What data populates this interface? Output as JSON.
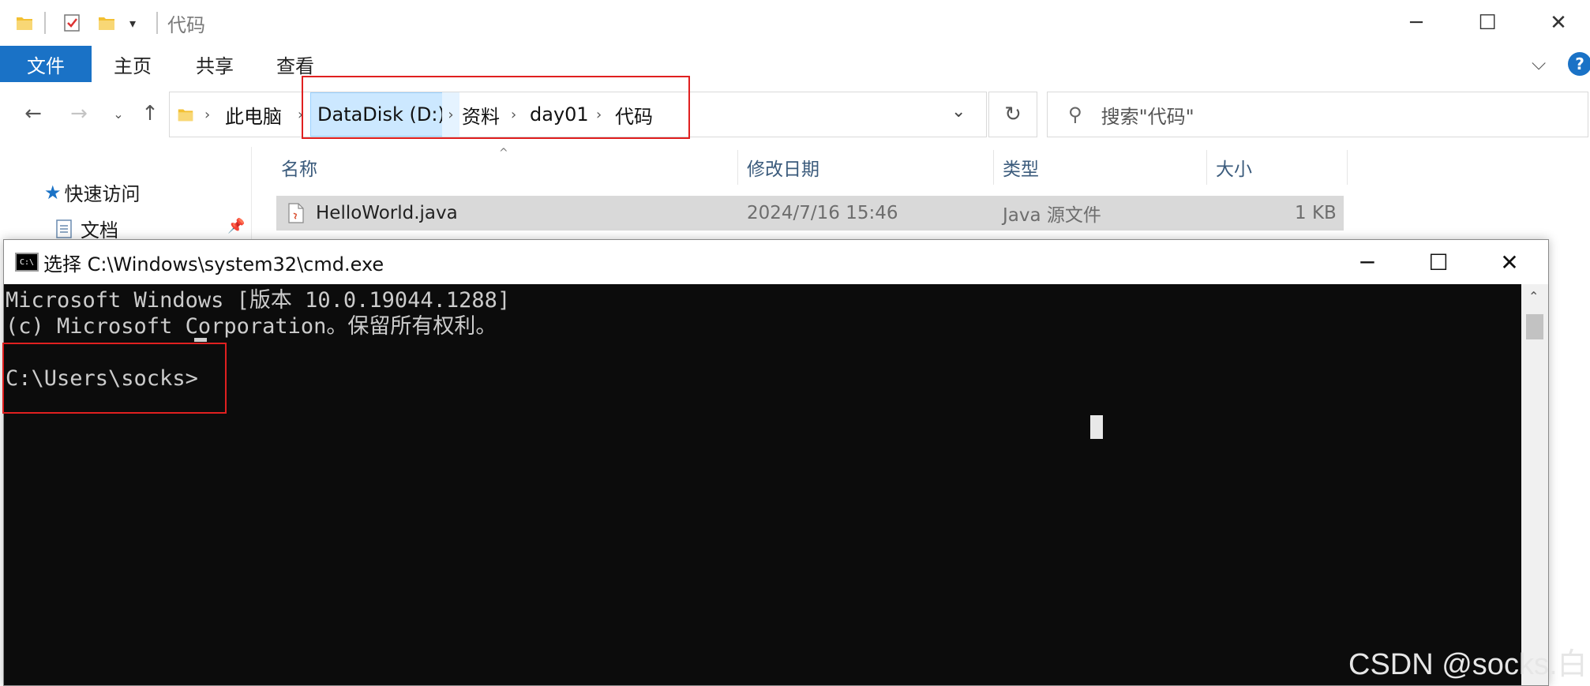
{
  "explorer": {
    "title": "代码",
    "ribbon_tabs": [
      "文件",
      "主页",
      "共享",
      "查看"
    ],
    "address": {
      "crumbs": [
        "此电脑",
        "DataDisk (D:)",
        "资料",
        "day01",
        "代码"
      ]
    },
    "search_placeholder": "搜索\"代码\"",
    "nav_pane": {
      "quick_access": "快速访问",
      "documents": "文档"
    },
    "columns": [
      "名称",
      "修改日期",
      "类型",
      "大小"
    ],
    "files": [
      {
        "name": "HelloWorld.java",
        "modified": "2024/7/16 15:46",
        "type": "Java 源文件",
        "size": "1 KB"
      }
    ]
  },
  "cmd": {
    "title": "选择 C:\\Windows\\system32\\cmd.exe",
    "lines": [
      "Microsoft Windows [版本 10.0.19044.1288]",
      "(c) Microsoft Corporation。保留所有权利。",
      "",
      "C:\\Users\\socks>"
    ]
  },
  "watermark": "CSDN @socks.白",
  "colors": {
    "accent": "#1a72c6",
    "highlight": "#e02020",
    "console_bg": "#0c0c0c",
    "console_fg": "#cccccc"
  }
}
